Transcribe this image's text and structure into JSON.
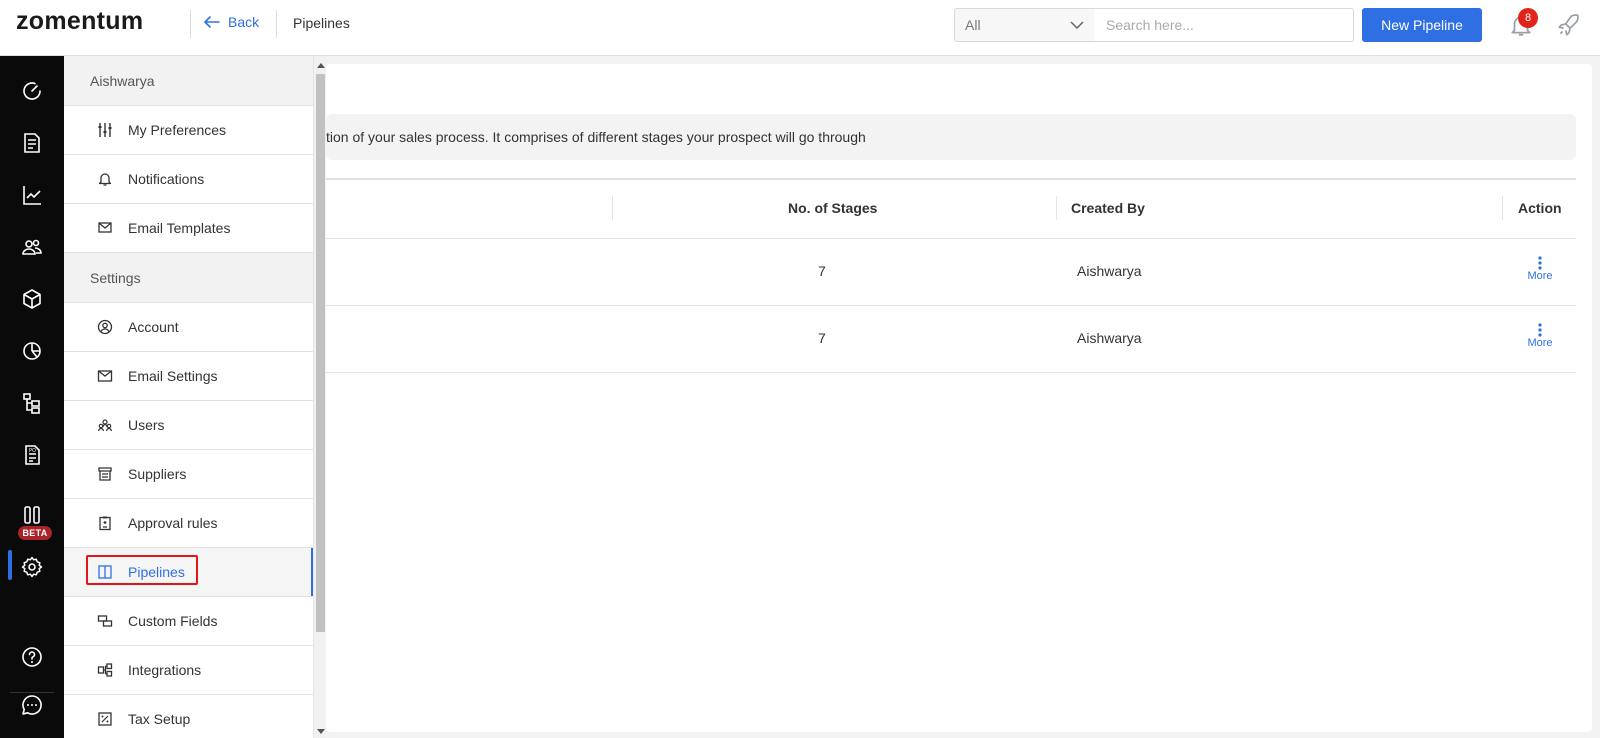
{
  "header": {
    "logo": "zomentum",
    "back_label": "Back",
    "breadcrumb": "Pipelines",
    "filter_value": "All",
    "search_placeholder": "Search here...",
    "new_button": "New Pipeline",
    "notification_count": "8"
  },
  "rail": {
    "items": [
      "dashboard-icon",
      "documents-icon",
      "reports-icon",
      "clients-icon",
      "products-icon",
      "analytics-icon",
      "workflow-icon",
      "purchase-order-icon",
      "pipelines-board-icon",
      "settings-icon",
      "help-icon",
      "chat-icon"
    ],
    "beta_label": "BETA",
    "active": "settings-icon"
  },
  "drawer": {
    "user_section": "Aishwarya",
    "user_items": [
      {
        "label": "My Preferences",
        "icon": "sliders-icon"
      },
      {
        "label": "Notifications",
        "icon": "bell-icon"
      },
      {
        "label": "Email Templates",
        "icon": "mail-icon"
      }
    ],
    "settings_section": "Settings",
    "settings_items": [
      {
        "label": "Account",
        "icon": "user-circle-icon"
      },
      {
        "label": "Email Settings",
        "icon": "envelope-icon"
      },
      {
        "label": "Users",
        "icon": "users-icon"
      },
      {
        "label": "Suppliers",
        "icon": "store-icon"
      },
      {
        "label": "Approval rules",
        "icon": "clipboard-icon"
      },
      {
        "label": "Pipelines",
        "icon": "columns-icon",
        "active": true
      },
      {
        "label": "Custom Fields",
        "icon": "fields-icon"
      },
      {
        "label": "Integrations",
        "icon": "integrations-icon"
      },
      {
        "label": "Tax Setup",
        "icon": "tax-icon"
      }
    ]
  },
  "main": {
    "info_text": "tion of your sales process. It comprises of different stages your prospect will go through",
    "columns": [
      "No. of Stages",
      "Created By",
      "Action"
    ],
    "rows": [
      {
        "stages": "7",
        "created_by": "Aishwarya",
        "action": "More"
      },
      {
        "stages": "7",
        "created_by": "Aishwarya",
        "action": "More"
      }
    ]
  },
  "colors": {
    "accent": "#2f6fe4",
    "rail_bg": "#0a0a0a",
    "badge": "#e2231a",
    "highlight_border": "#e1141a"
  }
}
